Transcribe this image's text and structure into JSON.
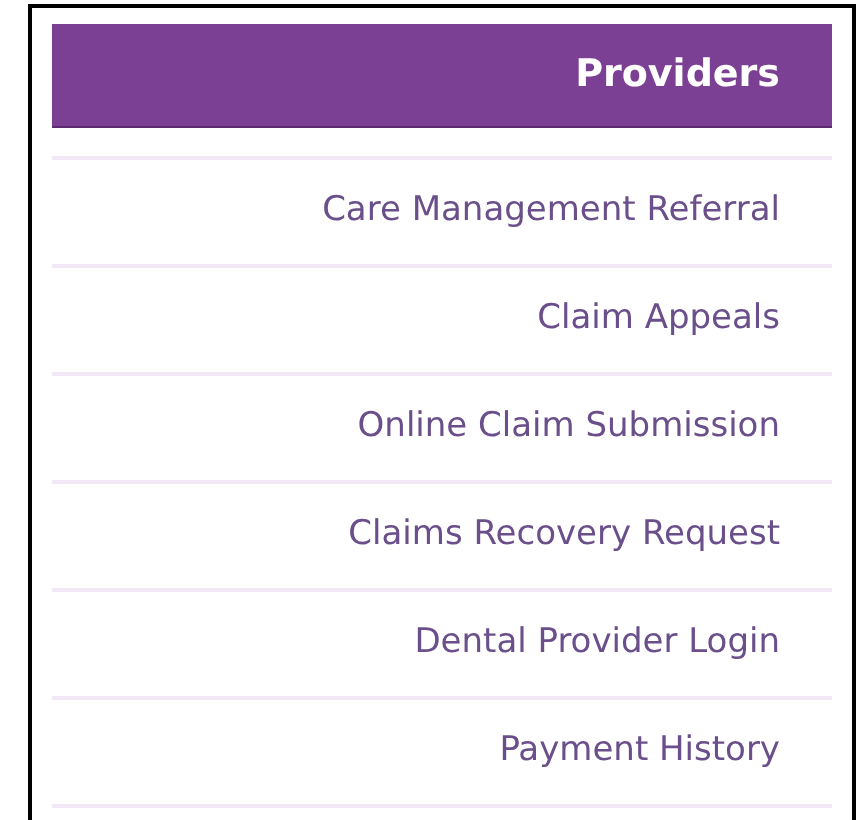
{
  "panel": {
    "title": "Providers",
    "links": [
      "Care Management Referral",
      "Claim Appeals",
      "Online Claim Submission",
      "Claims Recovery Request",
      "Dental Provider Login",
      "Payment History"
    ]
  }
}
